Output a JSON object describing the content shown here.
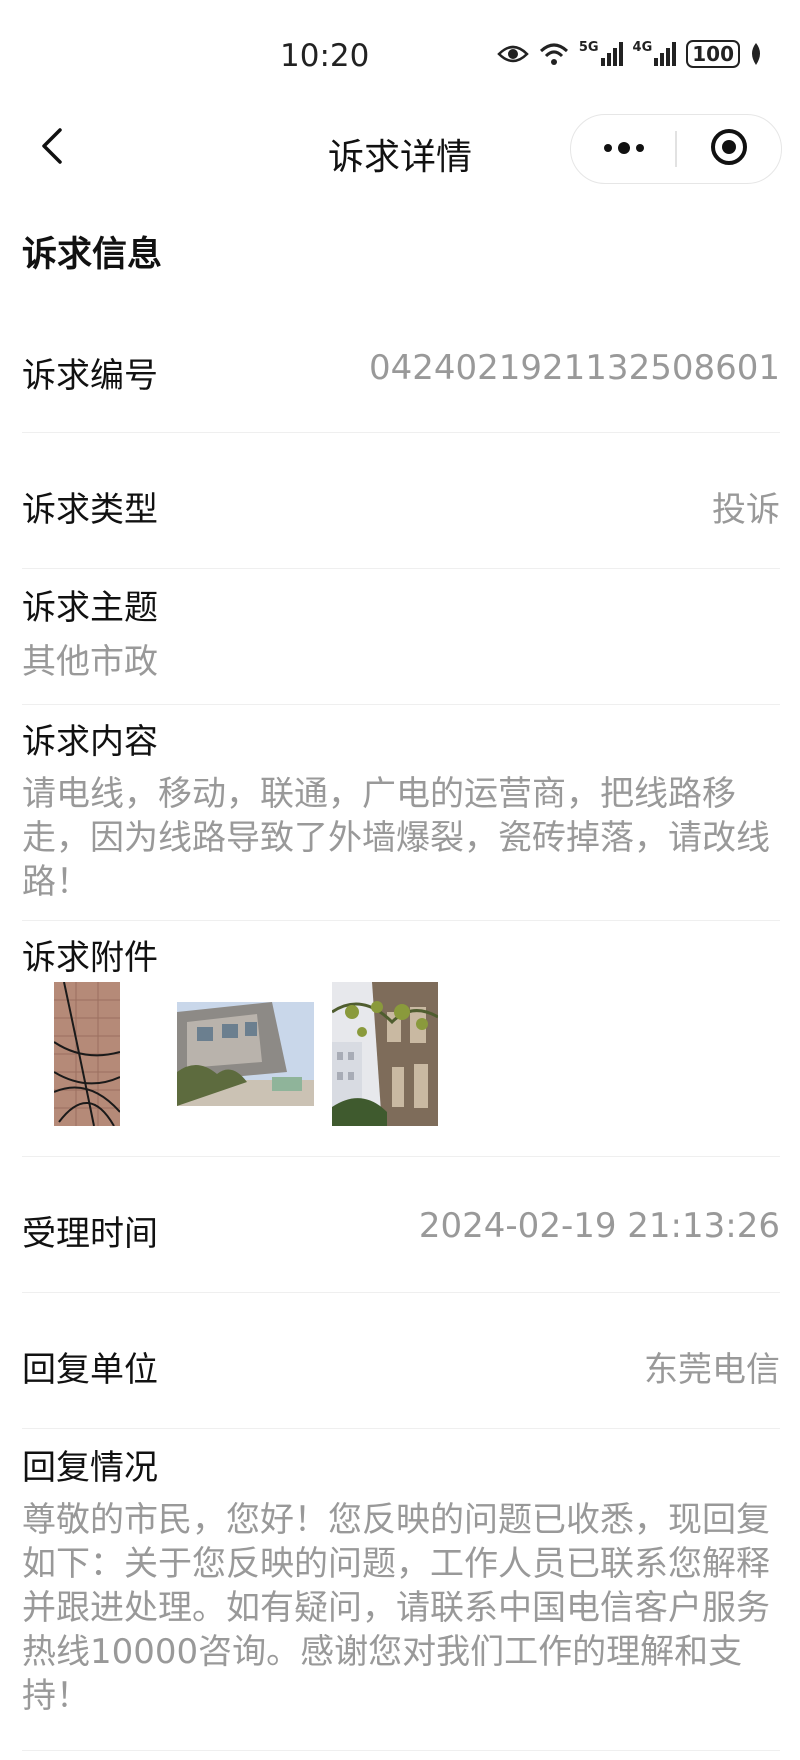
{
  "status_bar": {
    "time": "10:20",
    "network_5g": "5G",
    "network_4g": "4G",
    "battery": "100"
  },
  "nav": {
    "back_icon": "chevron-left-icon",
    "title": "诉求详情",
    "more_icon": "more-dots-icon",
    "close_icon": "target-circle-icon"
  },
  "section": {
    "title": "诉求信息"
  },
  "fields": {
    "number": {
      "label": "诉求编号",
      "value": "0424021921132508601"
    },
    "type": {
      "label": "诉求类型",
      "value": "投诉"
    },
    "topic": {
      "label": "诉求主题",
      "value": "其他市政"
    },
    "content": {
      "label": "诉求内容",
      "value": "请电线，移动，联通，广电的运营商，把线路移走，因为线路导致了外墙爆裂，瓷砖掉落，请改线路！"
    },
    "attachments": {
      "label": "诉求附件",
      "count": 3
    },
    "accept_time": {
      "label": "受理时间",
      "value": "2024-02-19 21:13:26"
    },
    "reply_unit": {
      "label": "回复单位",
      "value": "东莞电信"
    },
    "reply": {
      "label": "回复情况",
      "value": "尊敬的市民，您好！您反映的问题已收悉，现回复如下：关于您反映的问题，工作人员已联系您解释并跟进处理。如有疑问，请联系中国电信客户服务热线10000咨询。感谢您对我们工作的理解和支持！"
    }
  },
  "colors": {
    "label": "#111111",
    "value": "#999999",
    "divider": "#efefef"
  }
}
